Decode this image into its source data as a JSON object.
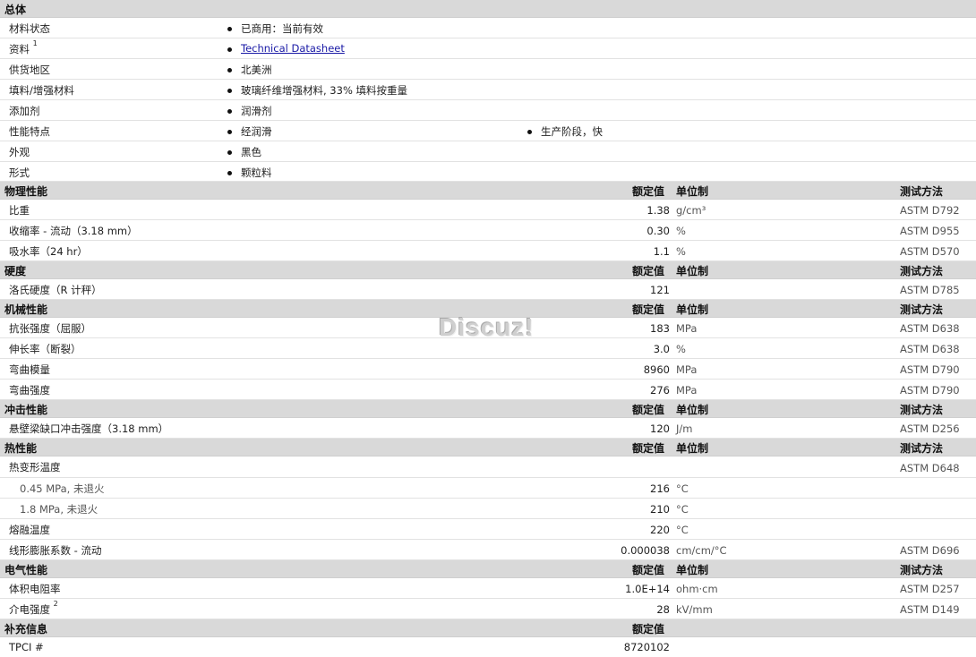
{
  "sections": {
    "general": "总体",
    "physical": "物理性能",
    "hardness": "硬度",
    "mechanical": "机械性能",
    "impact": "冲击性能",
    "thermal": "热性能",
    "electrical": "电气性能",
    "supplementary": "补充信息"
  },
  "columns": {
    "nominal": "额定值",
    "unit": "单位制",
    "method": "测试方法"
  },
  "general": {
    "status_label": "材料状态",
    "status_value": "已商用：当前有效",
    "docs_label": "资料",
    "docs_sup": "1",
    "docs_value": "Technical Datasheet",
    "region_label": "供货地区",
    "region_value": "北美洲",
    "filler_label": "填料/增强材料",
    "filler_value": "玻璃纤维增强材料, 33% 填料按重量",
    "additive_label": "添加剂",
    "additive_value": "润滑剂",
    "feature_label": "性能特点",
    "feature_value1": "经润滑",
    "feature_value2": "生产阶段，快",
    "appearance_label": "外观",
    "appearance_value": "黑色",
    "form_label": "形式",
    "form_value": "颗粒料"
  },
  "physical": [
    {
      "name": "比重",
      "value": "1.38",
      "unit": "g/cm³",
      "method": "ASTM D792"
    },
    {
      "name": "收缩率  - 流动（3.18 mm）",
      "value": "0.30",
      "unit": "%",
      "method": "ASTM D955"
    },
    {
      "name": "吸水率（24 hr）",
      "value": "1.1",
      "unit": "%",
      "method": "ASTM D570"
    }
  ],
  "hardness": [
    {
      "name": "洛氏硬度（R 计秤）",
      "value": "121",
      "unit": "",
      "method": "ASTM D785"
    }
  ],
  "mechanical": [
    {
      "name": "抗张强度（屈服）",
      "value": "183",
      "unit": "MPa",
      "method": "ASTM D638"
    },
    {
      "name": "伸长率（断裂）",
      "value": "3.0",
      "unit": "%",
      "method": "ASTM D638"
    },
    {
      "name": "弯曲模量",
      "value": "8960",
      "unit": "MPa",
      "method": "ASTM D790"
    },
    {
      "name": "弯曲强度",
      "value": "276",
      "unit": "MPa",
      "method": "ASTM D790"
    }
  ],
  "impact": [
    {
      "name": "悬壁梁缺口冲击强度（3.18 mm）",
      "value": "120",
      "unit": "J/m",
      "method": "ASTM D256"
    }
  ],
  "thermal": {
    "hdt_label": "热变形温度",
    "hdt_method": "ASTM D648",
    "hdt1_name": "0.45 MPa, 未退火",
    "hdt1_value": "216",
    "hdt1_unit": "°C",
    "hdt2_name": "1.8 MPa, 未退火",
    "hdt2_value": "210",
    "hdt2_unit": "°C",
    "melt_name": "熔融温度",
    "melt_value": "220",
    "melt_unit": "°C",
    "clte_name": "线形膨胀系数  - 流动",
    "clte_value": "0.000038",
    "clte_unit": "cm/cm/°C",
    "clte_method": "ASTM D696"
  },
  "electrical": [
    {
      "name": "体积电阻率",
      "sup": "",
      "value": "1.0E+14",
      "unit": "ohm·cm",
      "method": "ASTM D257"
    },
    {
      "name": "介电强度",
      "sup": "2",
      "value": "28",
      "unit": "kV/mm",
      "method": "ASTM D149"
    }
  ],
  "supplementary": {
    "tpci_label": "TPCI #",
    "tpci_value": "8720102"
  },
  "watermark": "Discuz!"
}
